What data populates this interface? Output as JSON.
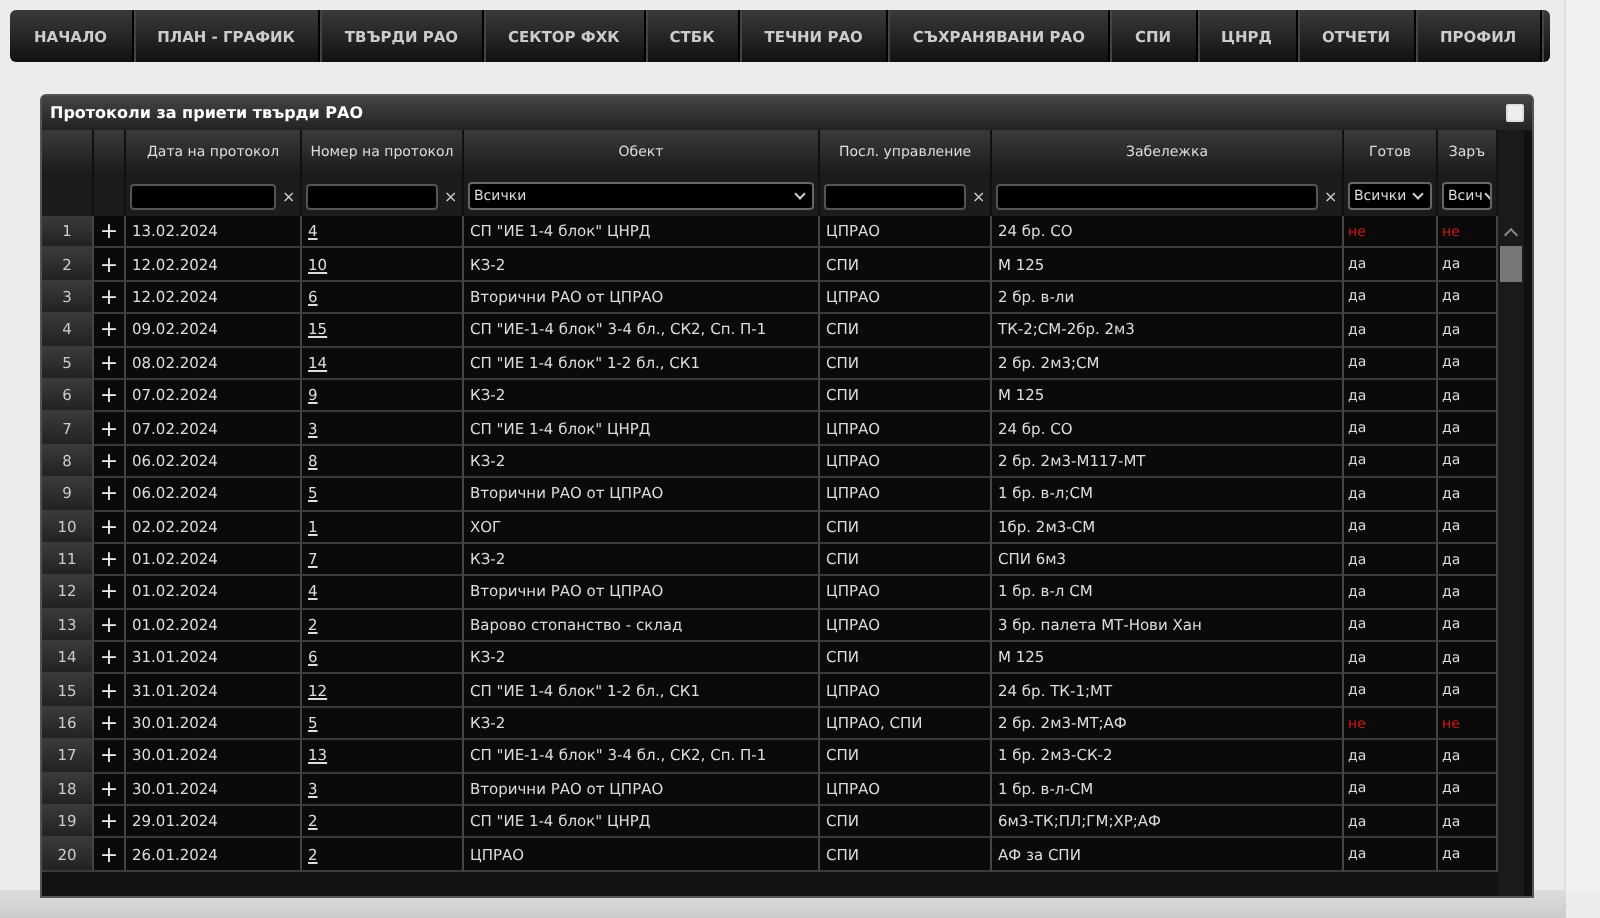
{
  "nav": [
    {
      "label": "НАЧАЛО"
    },
    {
      "label": "ПЛАН - ГРАФИК"
    },
    {
      "label": "ТВЪРДИ РАО"
    },
    {
      "label": "СЕКТОР ФХК"
    },
    {
      "label": "СТБК"
    },
    {
      "label": "ТЕЧНИ РАО"
    },
    {
      "label": "СЪХРАНЯВАНИ РАО"
    },
    {
      "label": "СПИ"
    },
    {
      "label": "ЦНРД"
    },
    {
      "label": "ОТЧЕТИ"
    },
    {
      "label": "ПРОФИЛ"
    }
  ],
  "panel": {
    "title": "Протоколи за приети твърди РАО",
    "columns": [
      {},
      {},
      {
        "label": "Дата на протокол"
      },
      {
        "label": "Номер на протокол"
      },
      {
        "label": "Обект"
      },
      {
        "label": "Посл. управление"
      },
      {
        "label": "Забележка"
      },
      {
        "label": "Готов"
      },
      {
        "label": "Заръ"
      }
    ],
    "filters": [
      {
        "kind": "none"
      },
      {
        "kind": "none"
      },
      {
        "kind": "text",
        "clear": "×"
      },
      {
        "kind": "text",
        "clear": "×"
      },
      {
        "kind": "select",
        "value": "Всички"
      },
      {
        "kind": "text",
        "clear": "×"
      },
      {
        "kind": "text",
        "clear": "×"
      },
      {
        "kind": "select",
        "value": "Всички"
      },
      {
        "kind": "select",
        "value": "Всич"
      }
    ],
    "rows": [
      {
        "num": "1",
        "expand": "+",
        "date": "13.02.2024",
        "number": "4",
        "object": "СП \"ИЕ 1-4 блок\" ЦНРД",
        "management": "ЦПРАО",
        "note": "24 бр. СО",
        "ready": "не",
        "ready_alert": true,
        "done": "не",
        "done_alert": true
      },
      {
        "num": "2",
        "expand": "+",
        "date": "12.02.2024",
        "number": "10",
        "object": "КЗ-2",
        "management": "СПИ",
        "note": "М 125",
        "ready": "да",
        "ready_alert": false,
        "done": "да",
        "done_alert": false
      },
      {
        "num": "3",
        "expand": "+",
        "date": "12.02.2024",
        "number": "6",
        "object": "Вторични РАО от ЦПРАО",
        "management": "ЦПРАО",
        "note": "2 бр. в-ли",
        "ready": "да",
        "ready_alert": false,
        "done": "да",
        "done_alert": false
      },
      {
        "num": "4",
        "expand": "+",
        "date": "09.02.2024",
        "number": "15",
        "object": "СП \"ИЕ-1-4 блок\" 3-4 бл., СК2, Сп. П-1",
        "management": "СПИ",
        "note": "ТК-2;СМ-2бр. 2м3",
        "ready": "да",
        "ready_alert": false,
        "done": "да",
        "done_alert": false
      },
      {
        "num": "5",
        "expand": "+",
        "date": "08.02.2024",
        "number": "14",
        "object": "СП \"ИЕ 1-4 блок\" 1-2 бл., СК1",
        "management": "СПИ",
        "note": "2 бр. 2м3;СМ",
        "ready": "да",
        "ready_alert": false,
        "done": "да",
        "done_alert": false
      },
      {
        "num": "6",
        "expand": "+",
        "date": "07.02.2024",
        "number": "9",
        "object": "КЗ-2",
        "management": "СПИ",
        "note": "М 125",
        "ready": "да",
        "ready_alert": false,
        "done": "да",
        "done_alert": false
      },
      {
        "num": "7",
        "expand": "+",
        "date": "07.02.2024",
        "number": "3",
        "object": "СП \"ИЕ 1-4 блок\" ЦНРД",
        "management": "ЦПРАО",
        "note": "24 бр. СО",
        "ready": "да",
        "ready_alert": false,
        "done": "да",
        "done_alert": false
      },
      {
        "num": "8",
        "expand": "+",
        "date": "06.02.2024",
        "number": "8",
        "object": "КЗ-2",
        "management": "ЦПРАО",
        "note": "2 бр. 2м3-М117-МТ",
        "ready": "да",
        "ready_alert": false,
        "done": "да",
        "done_alert": false
      },
      {
        "num": "9",
        "expand": "+",
        "date": "06.02.2024",
        "number": "5",
        "object": "Вторични РАО от ЦПРАО",
        "management": "ЦПРАО",
        "note": "1 бр. в-л;СМ",
        "ready": "да",
        "ready_alert": false,
        "done": "да",
        "done_alert": false
      },
      {
        "num": "10",
        "expand": "+",
        "date": "02.02.2024",
        "number": "1",
        "object": "ХОГ",
        "management": "СПИ",
        "note": "1бр. 2м3-СМ",
        "ready": "да",
        "ready_alert": false,
        "done": "да",
        "done_alert": false
      },
      {
        "num": "11",
        "expand": "+",
        "date": "01.02.2024",
        "number": "7",
        "object": "КЗ-2",
        "management": "СПИ",
        "note": "СПИ 6м3",
        "ready": "да",
        "ready_alert": false,
        "done": "да",
        "done_alert": false
      },
      {
        "num": "12",
        "expand": "+",
        "date": "01.02.2024",
        "number": "4",
        "object": "Вторични РАО от ЦПРАО",
        "management": "ЦПРАО",
        "note": "1 бр. в-л СМ",
        "ready": "да",
        "ready_alert": false,
        "done": "да",
        "done_alert": false
      },
      {
        "num": "13",
        "expand": "+",
        "date": "01.02.2024",
        "number": "2",
        "object": "Варово стопанство - склад",
        "management": "ЦПРАО",
        "note": "3 бр. палета МТ-Нови Хан",
        "ready": "да",
        "ready_alert": false,
        "done": "да",
        "done_alert": false
      },
      {
        "num": "14",
        "expand": "+",
        "date": "31.01.2024",
        "number": "6",
        "object": "КЗ-2",
        "management": "СПИ",
        "note": "М 125",
        "ready": "да",
        "ready_alert": false,
        "done": "да",
        "done_alert": false
      },
      {
        "num": "15",
        "expand": "+",
        "date": "31.01.2024",
        "number": "12",
        "object": "СП \"ИЕ 1-4 блок\" 1-2 бл., СК1",
        "management": "ЦПРАО",
        "note": "24 бр. ТК-1;МТ",
        "ready": "да",
        "ready_alert": false,
        "done": "да",
        "done_alert": false
      },
      {
        "num": "16",
        "expand": "+",
        "date": "30.01.2024",
        "number": "5",
        "object": "КЗ-2",
        "management": "ЦПРАО, СПИ",
        "note": "2 бр. 2м3-МТ;АФ",
        "ready": "не",
        "ready_alert": true,
        "done": "не",
        "done_alert": true
      },
      {
        "num": "17",
        "expand": "+",
        "date": "30.01.2024",
        "number": "13",
        "object": "СП \"ИЕ-1-4 блок\" 3-4 бл., СК2, Сп. П-1",
        "management": "СПИ",
        "note": "1 бр. 2м3-СК-2",
        "ready": "да",
        "ready_alert": false,
        "done": "да",
        "done_alert": false
      },
      {
        "num": "18",
        "expand": "+",
        "date": "30.01.2024",
        "number": "3",
        "object": "Вторични РАО от ЦПРАО",
        "management": "ЦПРАО",
        "note": "1 бр. в-л-СМ",
        "ready": "да",
        "ready_alert": false,
        "done": "да",
        "done_alert": false
      },
      {
        "num": "19",
        "expand": "+",
        "date": "29.01.2024",
        "number": "2",
        "object": "СП \"ИЕ 1-4 блок\" ЦНРД",
        "management": "СПИ",
        "note": "6м3-ТК;ПЛ;ГМ;ХР;АФ",
        "ready": "да",
        "ready_alert": false,
        "done": "да",
        "done_alert": false
      },
      {
        "num": "20",
        "expand": "+",
        "date": "26.01.2024",
        "number": "2",
        "object": "ЦПРАО",
        "management": "СПИ",
        "note": "АФ за СПИ",
        "ready": "да",
        "ready_alert": false,
        "done": "да",
        "done_alert": false
      }
    ]
  }
}
